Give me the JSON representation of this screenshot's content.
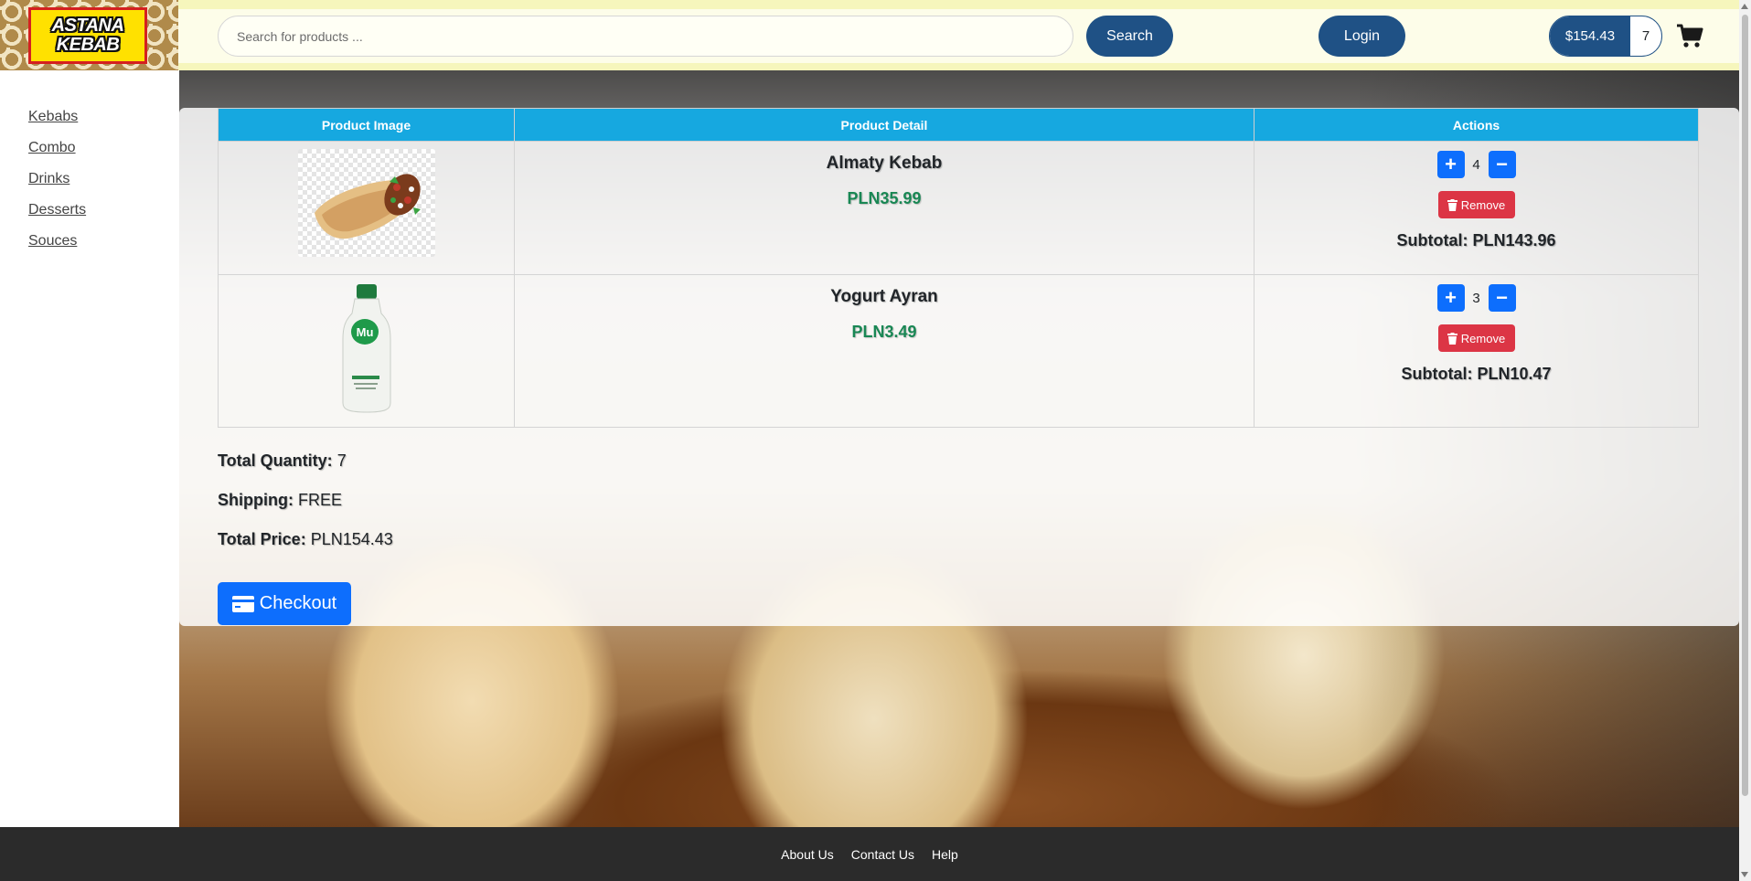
{
  "brand": {
    "logo_line1": "ASTANA",
    "logo_line2": "KEBAB"
  },
  "header": {
    "search_placeholder": "Search for products ...",
    "search_label": "Search",
    "login_label": "Login",
    "cart_total": "$154.43",
    "cart_count": "7",
    "cart_icon": "shopping-cart-icon"
  },
  "sidebar": {
    "items": [
      {
        "label": "Kebabs"
      },
      {
        "label": "Combo"
      },
      {
        "label": "Drinks"
      },
      {
        "label": "Desserts"
      },
      {
        "label": "Souces"
      }
    ]
  },
  "cart": {
    "columns": [
      "Product Image",
      "Product Detail",
      "Actions"
    ],
    "items": [
      {
        "name": "Almaty Kebab",
        "price": "PLN35.99",
        "quantity": "4",
        "remove_label": "Remove",
        "subtotal": "Subtotal: PLN143.96",
        "image": "kebab-wrap-image"
      },
      {
        "name": "Yogurt Ayran",
        "price": "PLN3.49",
        "quantity": "3",
        "remove_label": "Remove",
        "subtotal": "Subtotal: PLN10.47",
        "image": "ayran-bottle-image"
      }
    ],
    "summary": {
      "quantity_label": "Total Quantity:",
      "quantity_value": "7",
      "shipping_label": "Shipping:",
      "shipping_value": "FREE",
      "price_label": "Total Price:",
      "price_value": "PLN154.43"
    },
    "checkout_label": "Checkout"
  },
  "footer": {
    "links": [
      "About Us",
      "Contact Us",
      "Help"
    ]
  },
  "colors": {
    "primary": "#0d6efd",
    "navy": "#1f5185",
    "header_bg": "#fdfde9",
    "table_head": "#16a8e0",
    "danger": "#dc3545",
    "success": "#198754"
  }
}
